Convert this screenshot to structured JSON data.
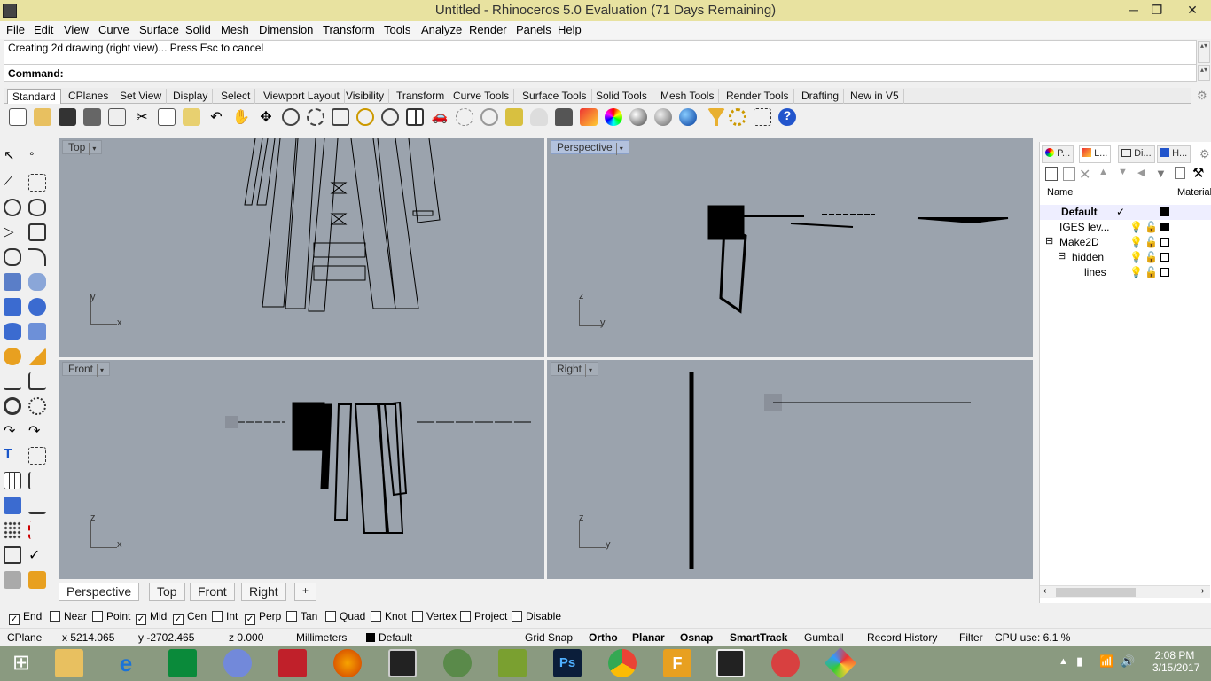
{
  "window": {
    "title": "Untitled - Rhinoceros 5.0 Evaluation (71 Days Remaining)",
    "minimize": "─",
    "maximize": "❐",
    "close": "✕"
  },
  "menu": [
    "File",
    "Edit",
    "View",
    "Curve",
    "Surface",
    "Solid",
    "Mesh",
    "Dimension",
    "Transform",
    "Tools",
    "Analyze",
    "Render",
    "Panels",
    "Help"
  ],
  "command": {
    "history": "Creating 2d drawing (right view)... Press Esc to cancel",
    "prompt": "Command:"
  },
  "toolbar_tabs": [
    "Standard",
    "CPlanes",
    "Set View",
    "Display",
    "Select",
    "Viewport Layout",
    "Visibility",
    "Transform",
    "Curve Tools",
    "Surface Tools",
    "Solid Tools",
    "Mesh Tools",
    "Render Tools",
    "Drafting",
    "New in V5"
  ],
  "viewports": {
    "top": "Top",
    "perspective": "Perspective",
    "front": "Front",
    "right": "Right"
  },
  "axes": {
    "x": "x",
    "y": "y",
    "z": "z"
  },
  "viewport_tabs": [
    "Perspective",
    "Top",
    "Front",
    "Right",
    "+"
  ],
  "panel": {
    "tabs": [
      "P...",
      "L...",
      "Di...",
      "H..."
    ],
    "col_name": "Name",
    "col_material": "Material",
    "layers": [
      {
        "name": "Default",
        "current": "✓",
        "color": "#000000",
        "bold": true
      },
      {
        "name": "IGES lev...",
        "color": "#000000"
      },
      {
        "name": "Make2D",
        "expander": "⊟",
        "color": "#ffffff"
      },
      {
        "name": "hidden",
        "expander": "⊟",
        "color": "#ffffff"
      },
      {
        "name": "lines",
        "color": "#ffffff"
      }
    ]
  },
  "osnaps": [
    {
      "label": "End",
      "checked": true
    },
    {
      "label": "Near",
      "checked": false
    },
    {
      "label": "Point",
      "checked": false
    },
    {
      "label": "Mid",
      "checked": true
    },
    {
      "label": "Cen",
      "checked": true
    },
    {
      "label": "Int",
      "checked": false
    },
    {
      "label": "Perp",
      "checked": true
    },
    {
      "label": "Tan",
      "checked": false
    },
    {
      "label": "Quad",
      "checked": false
    },
    {
      "label": "Knot",
      "checked": false
    },
    {
      "label": "Vertex",
      "checked": false
    },
    {
      "label": "Project",
      "checked": false
    },
    {
      "label": "Disable",
      "checked": false
    }
  ],
  "status": {
    "cplane": "CPlane",
    "x": "x 5214.065",
    "y": "y -2702.465",
    "z": "z 0.000",
    "units": "Millimeters",
    "layer": "Default",
    "grid_snap": "Grid Snap",
    "ortho": "Ortho",
    "planar": "Planar",
    "osnap": "Osnap",
    "smarttrack": "SmartTrack",
    "gumball": "Gumball",
    "record_history": "Record History",
    "filter": "Filter",
    "cpu": "CPU use: 6.1 %"
  },
  "taskbar": {
    "time": "2:08 PM",
    "date": "3/15/2017"
  }
}
